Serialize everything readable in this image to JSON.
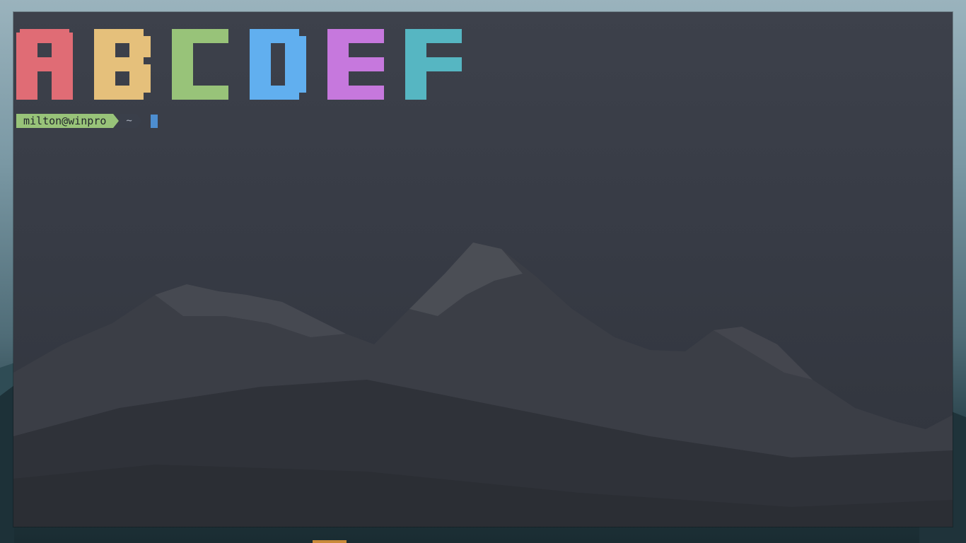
{
  "colors": {
    "red": "#e06c75",
    "yellow": "#e5c07b",
    "green": "#98c379",
    "blue": "#61afef",
    "magenta": "#c678dd",
    "cyan": "#56b6c2",
    "dir_bg": "#3a3f4a",
    "cursor": "#4d8ed0"
  },
  "banner": {
    "letters": [
      {
        "char": "A",
        "color": "#e06c75"
      },
      {
        "char": "B",
        "color": "#e5c07b"
      },
      {
        "char": "C",
        "color": "#98c379"
      },
      {
        "char": "D",
        "color": "#61afef"
      },
      {
        "char": "E",
        "color": "#c678dd"
      },
      {
        "char": "F",
        "color": "#56b6c2"
      }
    ]
  },
  "prompt": {
    "user_host": "milton@winpro",
    "directory": "~"
  },
  "icons": {
    "segment_separator": "powerline-arrow-icon",
    "cursor": "block-cursor-icon"
  }
}
